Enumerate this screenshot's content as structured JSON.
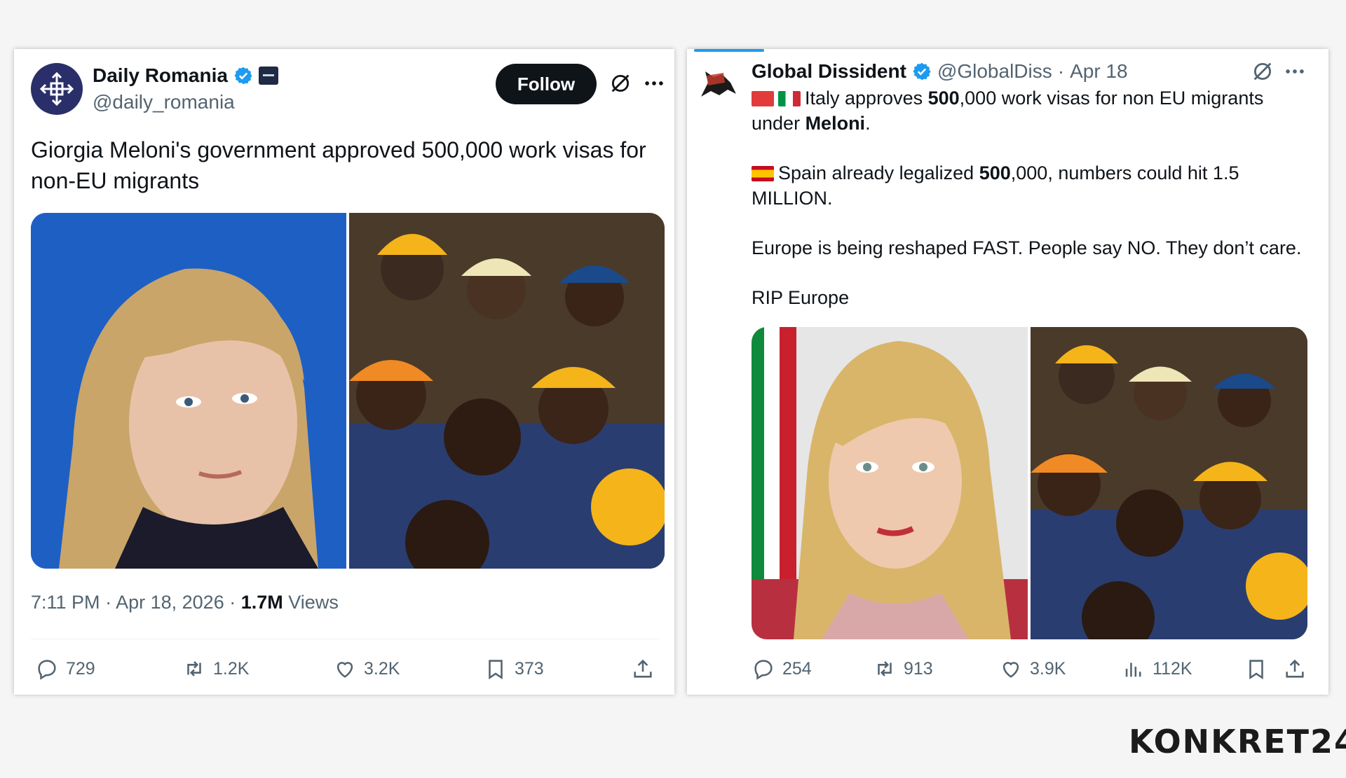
{
  "left_post": {
    "author_name": "Daily Romania",
    "handle": "@daily_romania",
    "follow_label": "Follow",
    "text": "Giorgia Meloni's government approved 500,000 work visas for non-EU migrants",
    "time": "7:11 PM",
    "date": "Apr 18, 2026",
    "views_count": "1.7M",
    "views_label": "Views",
    "actions": {
      "replies": "729",
      "reposts": "1.2K",
      "likes": "3.2K",
      "bookmarks": "373"
    },
    "icons": [
      "verified-badge-icon",
      "grok-icon",
      "more-icon",
      "reply-icon",
      "repost-icon",
      "like-icon",
      "bookmark-icon",
      "share-icon"
    ]
  },
  "right_post": {
    "author_name": "Global Dissident",
    "handle": "@GlobalDiss",
    "separator": "·",
    "date": "Apr 18",
    "paragraphs": {
      "p1_pre": "Italy approves ",
      "p1_bold1": "500",
      "p1_mid": ",000 work visas for non EU migrants under ",
      "p1_bold2": "Meloni",
      "p1_post": ".",
      "p2_pre": "Spain already legalized ",
      "p2_bold": "500",
      "p2_post": ",000, numbers could hit 1.5 MILLION.",
      "p3": "Europe is being reshaped FAST. People say NO. They don’t care.",
      "p4": "RIP Europe"
    },
    "actions": {
      "replies": "254",
      "reposts": "913",
      "likes": "3.9K",
      "views": "112K"
    }
  },
  "watermark": "KONKRET24",
  "colors": {
    "accent_blue": "#1d9bf0",
    "text_primary": "#0f1419",
    "text_secondary": "#536471",
    "follow_button": "#0f1419"
  }
}
